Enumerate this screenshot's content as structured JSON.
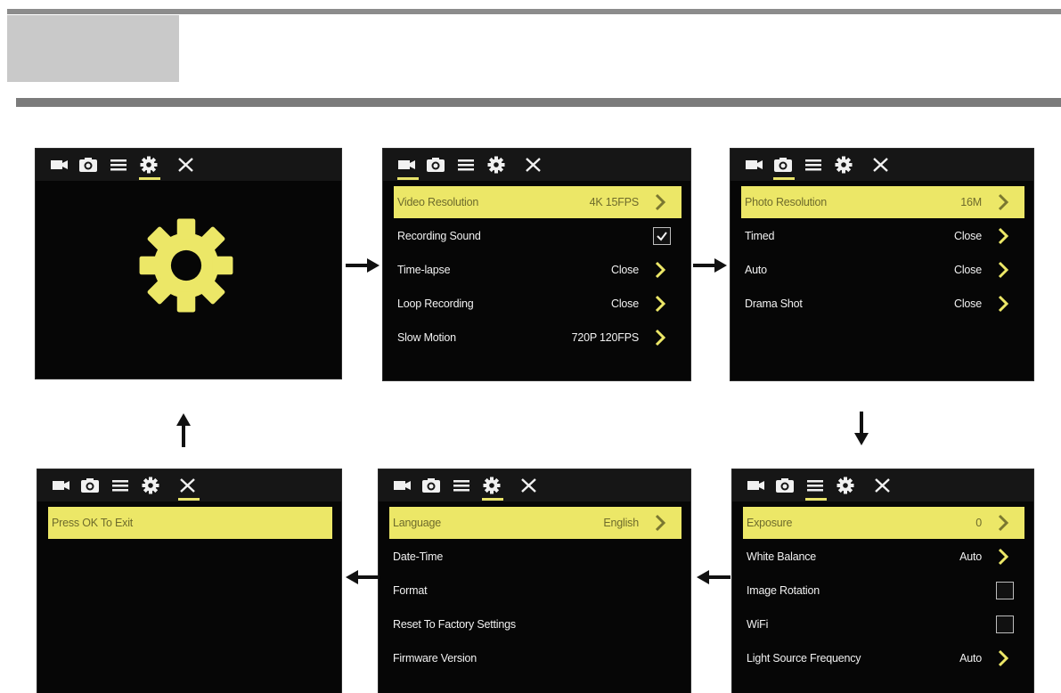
{
  "colors": {
    "highlight": "#ece767",
    "screen_bg": "#060606",
    "text": "#f1f1f1",
    "gear": "#ece767"
  },
  "tab_icons": [
    "video-camera-icon",
    "photo-camera-icon",
    "list-menu-icon",
    "gear-icon",
    "close-icon"
  ],
  "screens": {
    "settings_home": {
      "active_tab": "gear"
    },
    "video_menu": {
      "active_tab": "video",
      "rows": [
        {
          "label": "Video Resolution",
          "value": "4K 15FPS",
          "control": "chevron",
          "highlighted": true
        },
        {
          "label": "Recording Sound",
          "value": "",
          "control": "checkbox",
          "checked": true
        },
        {
          "label": "Time-lapse",
          "value": "Close",
          "control": "chevron"
        },
        {
          "label": "Loop Recording",
          "value": "Close",
          "control": "chevron"
        },
        {
          "label": "Slow Motion",
          "value": "720P 120FPS",
          "control": "chevron"
        }
      ]
    },
    "photo_menu": {
      "active_tab": "photo",
      "rows": [
        {
          "label": "Photo Resolution",
          "value": "16M",
          "control": "chevron",
          "highlighted": true
        },
        {
          "label": "Timed",
          "value": "Close",
          "control": "chevron"
        },
        {
          "label": "Auto",
          "value": "Close",
          "control": "chevron"
        },
        {
          "label": "Drama Shot",
          "value": "Close",
          "control": "chevron"
        }
      ]
    },
    "general_menu": {
      "active_tab": "list",
      "rows": [
        {
          "label": "Exposure",
          "value": "0",
          "control": "chevron",
          "highlighted": true
        },
        {
          "label": "White Balance",
          "value": "Auto",
          "control": "chevron"
        },
        {
          "label": "Image Rotation",
          "value": "",
          "control": "checkbox",
          "checked": false
        },
        {
          "label": "WiFi",
          "value": "",
          "control": "checkbox",
          "checked": false
        },
        {
          "label": "Light Source Frequency",
          "value": "Auto",
          "control": "chevron"
        }
      ]
    },
    "system_menu": {
      "active_tab": "gear",
      "rows": [
        {
          "label": "Language",
          "value": "English",
          "control": "chevron",
          "highlighted": true
        },
        {
          "label": "Date-Time",
          "value": "",
          "control": "none"
        },
        {
          "label": "Format",
          "value": "",
          "control": "none"
        },
        {
          "label": "Reset To Factory Settings",
          "value": "",
          "control": "none"
        },
        {
          "label": "Firmware Version",
          "value": "",
          "control": "none"
        }
      ]
    },
    "exit_menu": {
      "active_tab": "close",
      "rows": [
        {
          "label": "Press OK To Exit",
          "value": "",
          "control": "none",
          "highlighted": true
        }
      ]
    }
  },
  "flow_arrows": [
    "right",
    "right",
    "down",
    "left",
    "left",
    "up"
  ]
}
